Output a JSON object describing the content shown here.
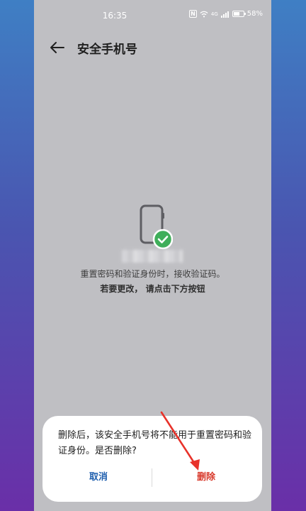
{
  "status_bar": {
    "time": "16:35",
    "nfc": "N",
    "signal": "4G",
    "battery": "58%"
  },
  "header": {
    "title": "安全手机号",
    "back_icon": "arrow-left-icon"
  },
  "content": {
    "description_line1": "重置密码和验证身份时，接收验证码。",
    "description_line2": "若要更改， 请点击下方按钮"
  },
  "dialog": {
    "message": "删除后，该安全手机号将不能用于重置密码和验证身份。是否删除?",
    "cancel_label": "取消",
    "delete_label": "删除"
  },
  "colors": {
    "accent_blue": "#1f5fae",
    "danger_red": "#d8392b",
    "check_green": "#3fae5a",
    "annotation_red": "#e8322a"
  }
}
